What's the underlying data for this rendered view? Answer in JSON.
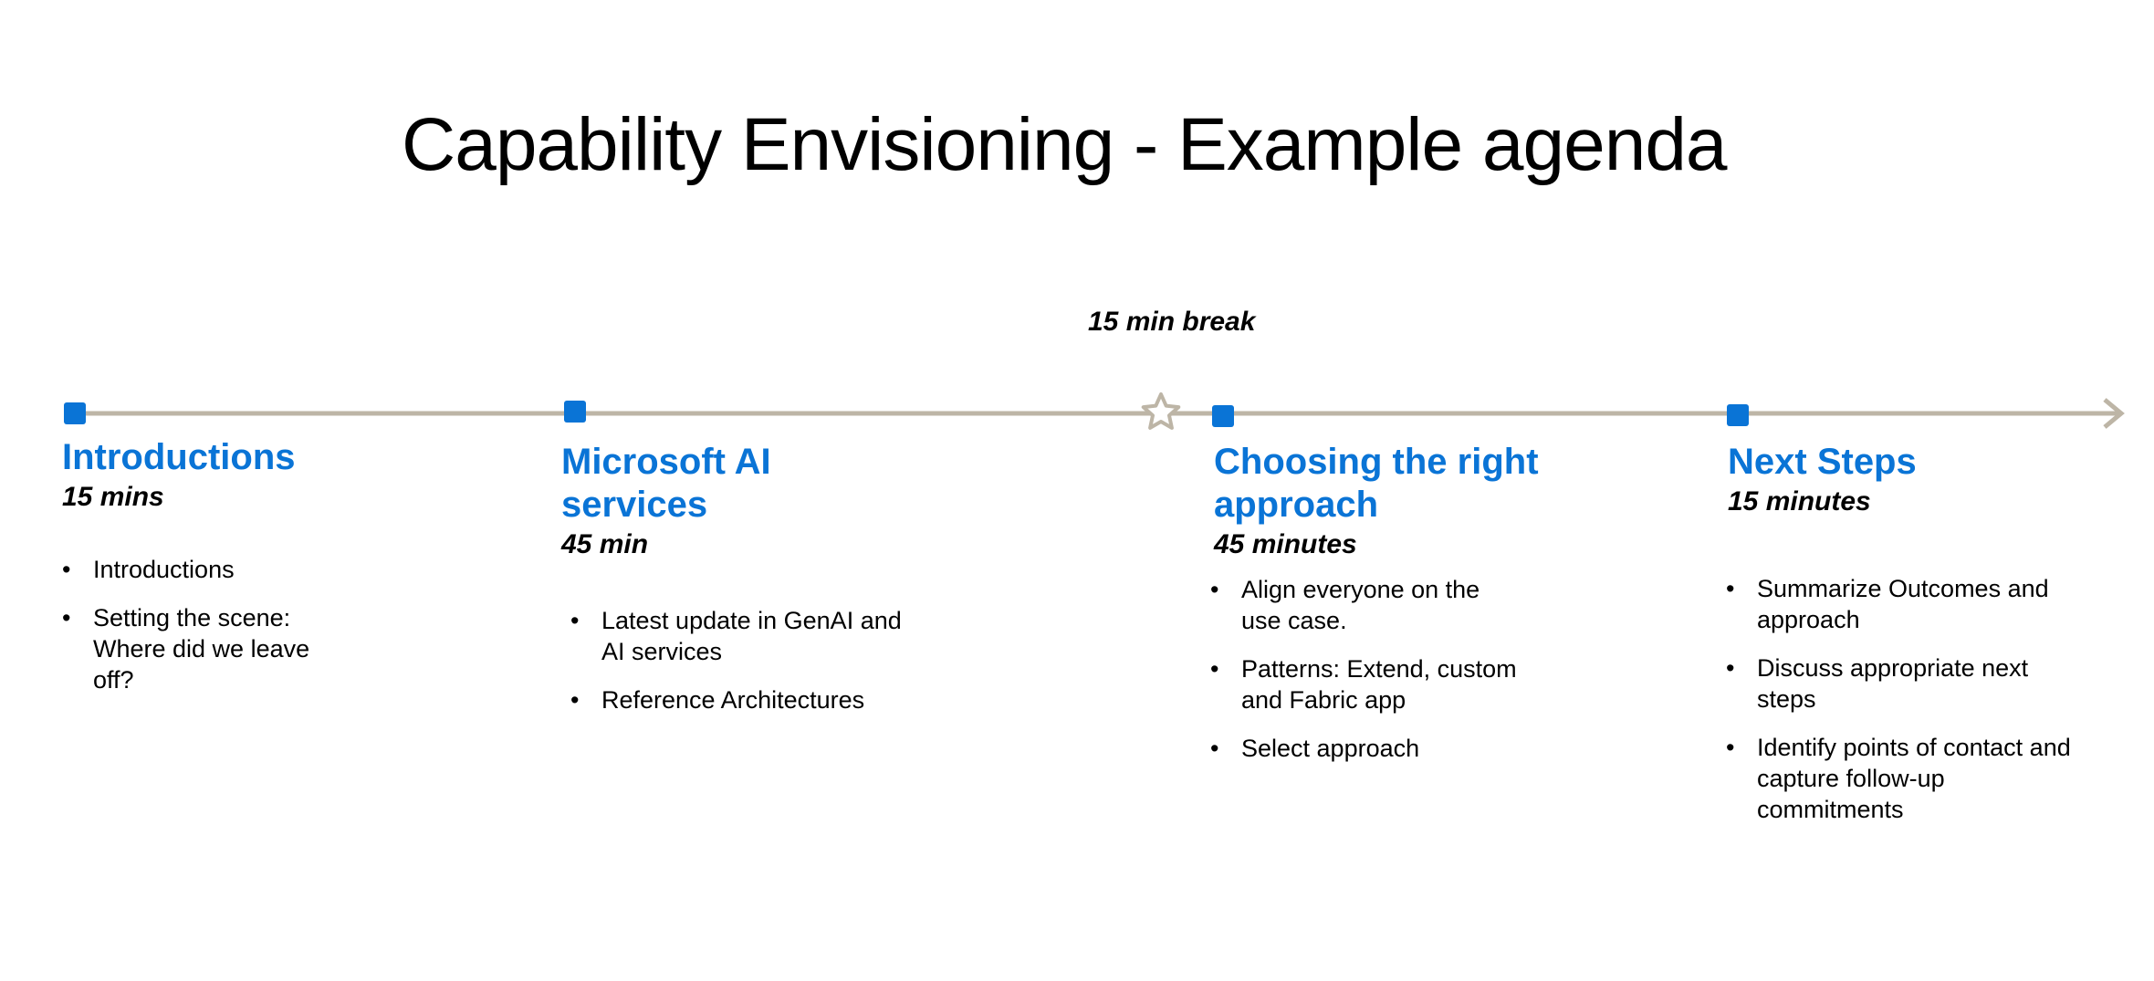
{
  "title": "Capability Envisioning - Example agenda",
  "break_label": "15 min break",
  "colors": {
    "accent": "#0a74d6",
    "timeline": "#bdb5a6",
    "text": "#000000"
  },
  "icons": {
    "milestone": "square-marker",
    "break": "star-outline-icon",
    "end": "arrow-head-icon"
  },
  "stages": [
    {
      "title": "Introductions",
      "duration": "15 mins",
      "bullets": [
        "Introductions",
        "Setting the scene: Where did we leave off?"
      ]
    },
    {
      "title": "Microsoft AI services",
      "duration": "45 min",
      "bullets": [
        "Latest update in GenAI and AI services",
        "Reference Architectures"
      ]
    },
    {
      "title": "Choosing the right approach",
      "duration": "45 minutes",
      "bullets": [
        "Align everyone on the use case.",
        "Patterns: Extend, custom and Fabric app",
        "Select approach"
      ]
    },
    {
      "title": "Next Steps",
      "duration": "15 minutes",
      "bullets": [
        "Summarize Outcomes and approach",
        "Discuss appropriate next steps",
        "Identify points of contact and capture follow-up commitments"
      ]
    }
  ]
}
